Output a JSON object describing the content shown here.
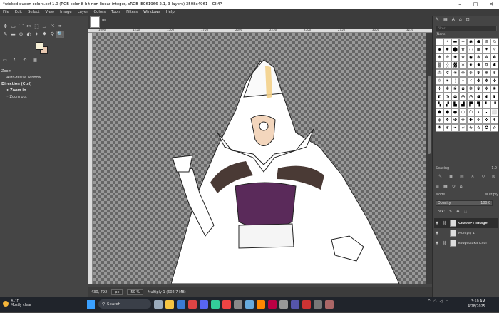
{
  "window": {
    "title": "*wicked queen colors.xcf-1.0 (RGB color 8-bit non-linear integer, sRGB IEC61966-2.1, 3 layers) 3508x4961 – GIMP",
    "minimize": "–",
    "maximize": "□",
    "close": "✕"
  },
  "menu": [
    "File",
    "Edit",
    "Select",
    "View",
    "Image",
    "Layer",
    "Colors",
    "Tools",
    "Filters",
    "Windows",
    "Help"
  ],
  "toolbox": {
    "row1": [
      "✥",
      "▭",
      "⌒",
      "✂",
      "⬚",
      "▱",
      "⤧",
      "✒"
    ],
    "row2": [
      "✎",
      "▬",
      "⊕",
      "◐",
      "✦",
      "⬥",
      "⚲",
      "🔍"
    ]
  },
  "tool_options": {
    "tabs": [
      "▭",
      "↻",
      "↶",
      "▦"
    ],
    "title": "Zoom",
    "auto_resize": "Auto-resize window",
    "direction_label": "Direction  (Ctrl)",
    "zoom_in": "Zoom in",
    "zoom_out": "Zoom out"
  },
  "left_bottom": [
    "⤓",
    "↻",
    "✕",
    "↺"
  ],
  "image_tab_close": "⊠",
  "ruler_ticks": [
    "1000",
    "1250",
    "1500",
    "1750",
    "2000",
    "2250",
    "2500",
    "2750",
    "3000",
    "3250"
  ],
  "status": {
    "coords": "430, 792",
    "unit": "px",
    "zoom": "50 %",
    "layer_info": "Multiply 1 (602.7 MB)"
  },
  "brushes": {
    "tabs": [
      "✎",
      "▦",
      "A",
      "⌂",
      "⊡"
    ],
    "filter_placeholder": "filter",
    "current": "(None)",
    "spacing_label": "Spacing",
    "spacing_value": "1.0",
    "actions": [
      "✎",
      "▣",
      "▤",
      "✕",
      "↻",
      "⊠"
    ]
  },
  "layers_panel": {
    "tabs": [
      "≡",
      "▦",
      "↻",
      "⌂"
    ],
    "mode_label": "Mode",
    "mode_value": "Multiply",
    "opacity_label": "Opacity",
    "opacity_value": "100.0",
    "lock_label": "Lock:",
    "lock_icons": [
      "✎",
      "✥",
      "⬚"
    ],
    "layers": [
      {
        "name": "ChatGPT Image",
        "selected": true
      },
      {
        "name": "Multiply 1",
        "selected": false
      },
      {
        "name": "kougetsukanchoi",
        "selected": false
      }
    ],
    "bottom_actions": [
      "▭",
      "▣",
      "▤",
      "▲",
      "▼",
      "⊞",
      "⊗",
      "⌂",
      "⊠"
    ]
  },
  "taskbar": {
    "temp": "41°F",
    "weather": "Mostly clear",
    "search": "Search",
    "time": "3:50 AM",
    "date": "4/28/2025",
    "app_colors": [
      "#9ab",
      "#f5c542",
      "#3a7bd5",
      "#d44",
      "#5865f2",
      "#3c9",
      "#e44",
      "#888",
      "#6ad",
      "#f80",
      "#b04",
      "#999",
      "#55a",
      "#c33",
      "#777",
      "#a66"
    ]
  },
  "colors": {
    "foreground": "#f5efd5",
    "background": "#e8c8b0",
    "purple_bodice": "#5a2a5a",
    "fur": "#4a3a35"
  }
}
